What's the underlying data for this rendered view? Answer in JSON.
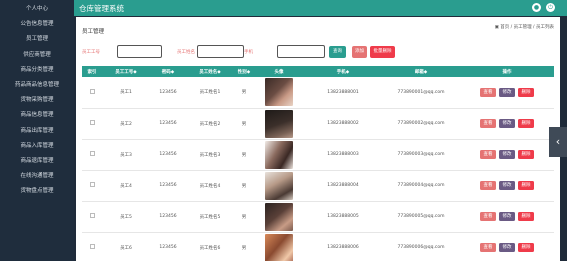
{
  "app_title": "仓库管理系统",
  "sidebar": {
    "items": [
      {
        "label": "个人中心"
      },
      {
        "label": "公告信息管理"
      },
      {
        "label": "员工管理"
      },
      {
        "label": "供应商管理"
      },
      {
        "label": "商品分类管理"
      },
      {
        "label": "药品商品信息管理"
      },
      {
        "label": "货物采购管理"
      },
      {
        "label": "商品信息管理"
      },
      {
        "label": "商品出库管理"
      },
      {
        "label": "商品入库管理"
      },
      {
        "label": "商品退库管理"
      },
      {
        "label": "在线沟通管理"
      },
      {
        "label": "货物盘点管理"
      }
    ]
  },
  "page": {
    "title": "员工管理",
    "breadcrumb": "▣ 首页 / 员工管理 / 员工列表"
  },
  "search": {
    "field1_label": "员工工号",
    "field2_label": "员工姓名",
    "field3_label": "手机",
    "search_button": "查询",
    "add_button": "添加",
    "batch_delete_button": "批量删除"
  },
  "table": {
    "headers": [
      "索引",
      "员工工号◆",
      "密码◆",
      "员工姓名◆",
      "性别◆",
      "头像",
      "手机◆",
      "邮箱◆",
      "操作"
    ],
    "rows": [
      {
        "id": "员工1",
        "password": "123456",
        "name": "员工姓名1",
        "gender": "男",
        "phone": "13823888001",
        "email": "773890001@qq.com"
      },
      {
        "id": "员工2",
        "password": "123456",
        "name": "员工姓名2",
        "gender": "男",
        "phone": "13823888002",
        "email": "773890002@qq.com"
      },
      {
        "id": "员工3",
        "password": "123456",
        "name": "员工姓名3",
        "gender": "男",
        "phone": "13823888003",
        "email": "773890003@qq.com"
      },
      {
        "id": "员工4",
        "password": "123456",
        "name": "员工姓名4",
        "gender": "男",
        "phone": "13823888004",
        "email": "773890004@qq.com"
      },
      {
        "id": "员工5",
        "password": "123456",
        "name": "员工姓名5",
        "gender": "男",
        "phone": "13823888005",
        "email": "773890005@qq.com"
      },
      {
        "id": "员工6",
        "password": "123456",
        "name": "员工姓名6",
        "gender": "男",
        "phone": "13823888006",
        "email": "773890006@qq.com"
      }
    ],
    "actions": {
      "view": "查看",
      "edit": "修改",
      "delete": "删除"
    }
  },
  "colors": {
    "accent": "#2a9d8f",
    "sidebar": "#1f2d3d",
    "view": "#e57373",
    "edit": "#6a5a84",
    "delete": "#ef3b4a"
  }
}
